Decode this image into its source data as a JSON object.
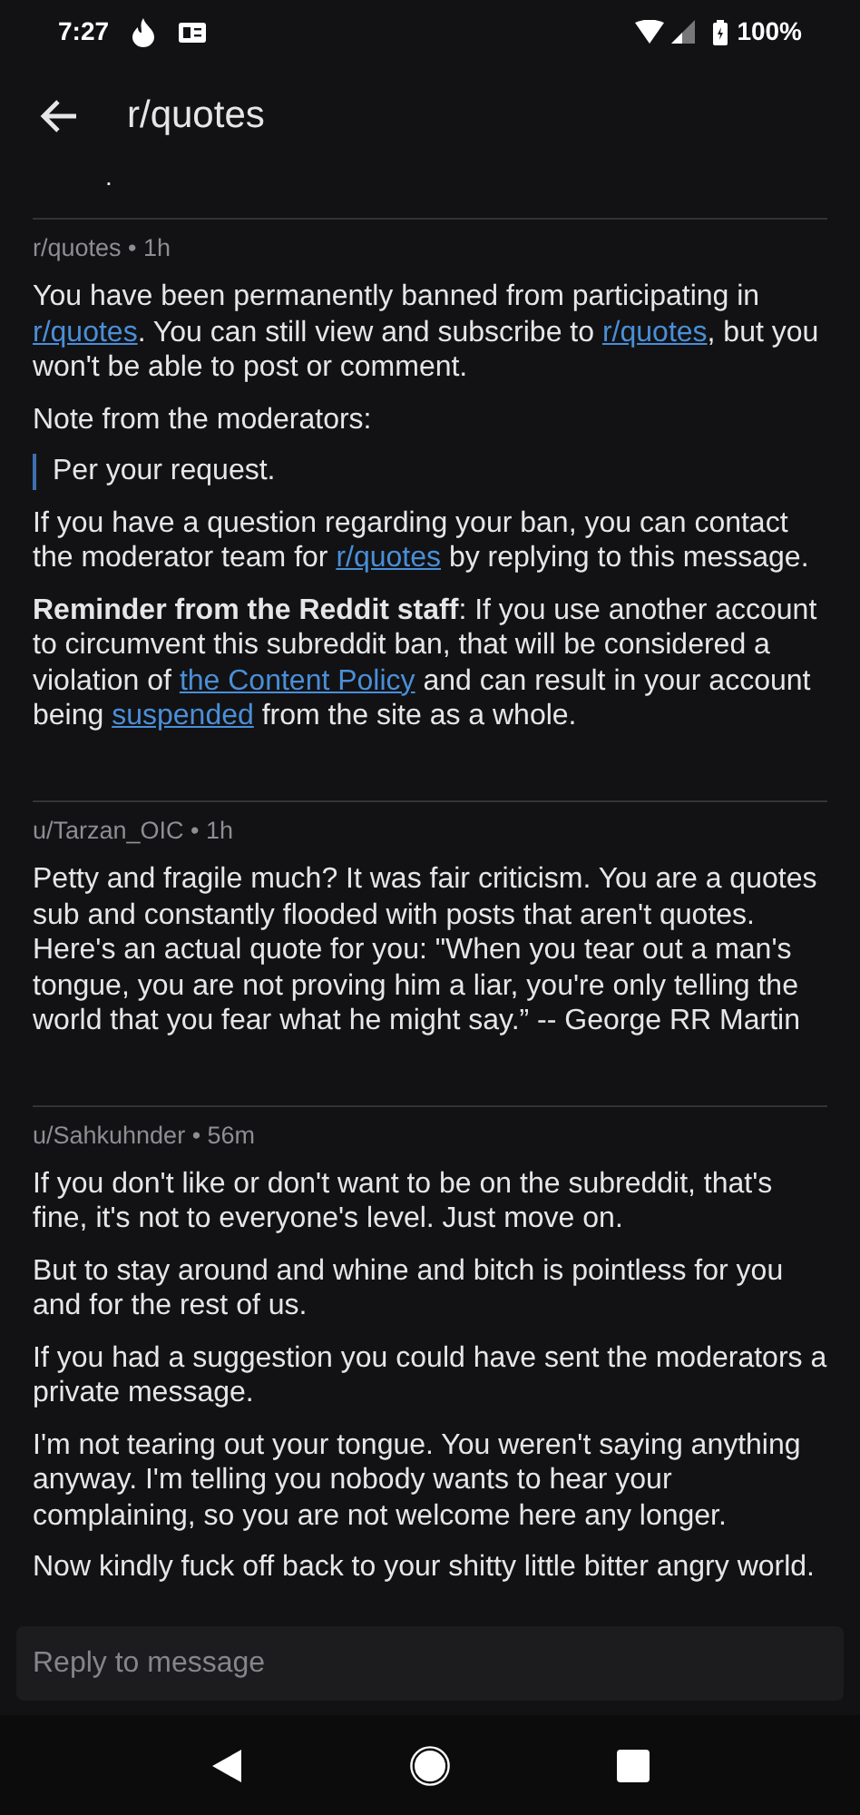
{
  "status_bar": {
    "time": "7:27",
    "battery": "100%"
  },
  "header": {
    "title": "r/quotes",
    "dot": "."
  },
  "messages": [
    {
      "meta": "r/quotes • 1h",
      "paragraphs": [
        {
          "kind": "text",
          "segments": [
            {
              "text": "You have been permanently banned from participating in ",
              "link": false
            },
            {
              "text": "r/quotes",
              "link": true
            },
            {
              "text": ". You can still view and subscribe to ",
              "link": false
            },
            {
              "text": "r/quotes",
              "link": true
            },
            {
              "text": ", but you won't be able to post or comment.",
              "link": false
            }
          ]
        },
        {
          "kind": "text",
          "segments": [
            {
              "text": "Note from the moderators:",
              "link": false
            }
          ]
        },
        {
          "kind": "quote",
          "segments": [
            {
              "text": "Per your request.",
              "link": false
            }
          ]
        },
        {
          "kind": "text",
          "segments": [
            {
              "text": "If you have a question regarding your ban, you can contact the moderator team for ",
              "link": false
            },
            {
              "text": "r/quotes",
              "link": true
            },
            {
              "text": " by replying to this message.",
              "link": false
            }
          ]
        },
        {
          "kind": "text",
          "segments": [
            {
              "text": "**Reminder from the Reddit staff**: If you use another account to circumvent this subreddit ban, that will be considered a violation of ",
              "link": false
            },
            {
              "text": "the Content Policy",
              "link": true
            },
            {
              "text": " and can result in your account being ",
              "link": false
            },
            {
              "text": "suspended",
              "link": true
            },
            {
              "text": " from the site as a whole.",
              "link": false
            }
          ]
        }
      ]
    },
    {
      "meta": "u/Tarzan_OIC • 1h",
      "paragraphs": [
        {
          "kind": "text",
          "segments": [
            {
              "text": "Petty and fragile much? It was fair criticism. You are a quotes sub and constantly flooded with posts that aren't quotes. Here's an actual quote for you: \"When you tear out a man's tongue, you are not proving him a liar, you're only telling the world that you fear what he might say.” -- George RR Martin",
              "link": false
            }
          ]
        }
      ]
    },
    {
      "meta": "u/Sahkuhnder • 56m",
      "paragraphs": [
        {
          "kind": "text",
          "segments": [
            {
              "text": "If you don't like or don't want to be on the subreddit, that's fine, it's not to everyone's level. Just move on.",
              "link": false
            }
          ]
        },
        {
          "kind": "text",
          "segments": [
            {
              "text": "But to stay around and whine and bitch is pointless for you and for the rest of us.",
              "link": false
            }
          ]
        },
        {
          "kind": "text",
          "segments": [
            {
              "text": "If you had a suggestion you could have sent the moderators a private message.",
              "link": false
            }
          ]
        },
        {
          "kind": "text",
          "segments": [
            {
              "text": "I'm not tearing out your tongue. You weren't saying anything anyway. I'm telling you nobody wants to hear your complaining, so you are not welcome here any longer.",
              "link": false
            }
          ]
        },
        {
          "kind": "text",
          "segments": [
            {
              "text": "Now kindly fuck off back to your shitty little bitter angry world.",
              "link": false
            }
          ]
        }
      ]
    }
  ],
  "reply": {
    "placeholder": "Reply to message"
  }
}
